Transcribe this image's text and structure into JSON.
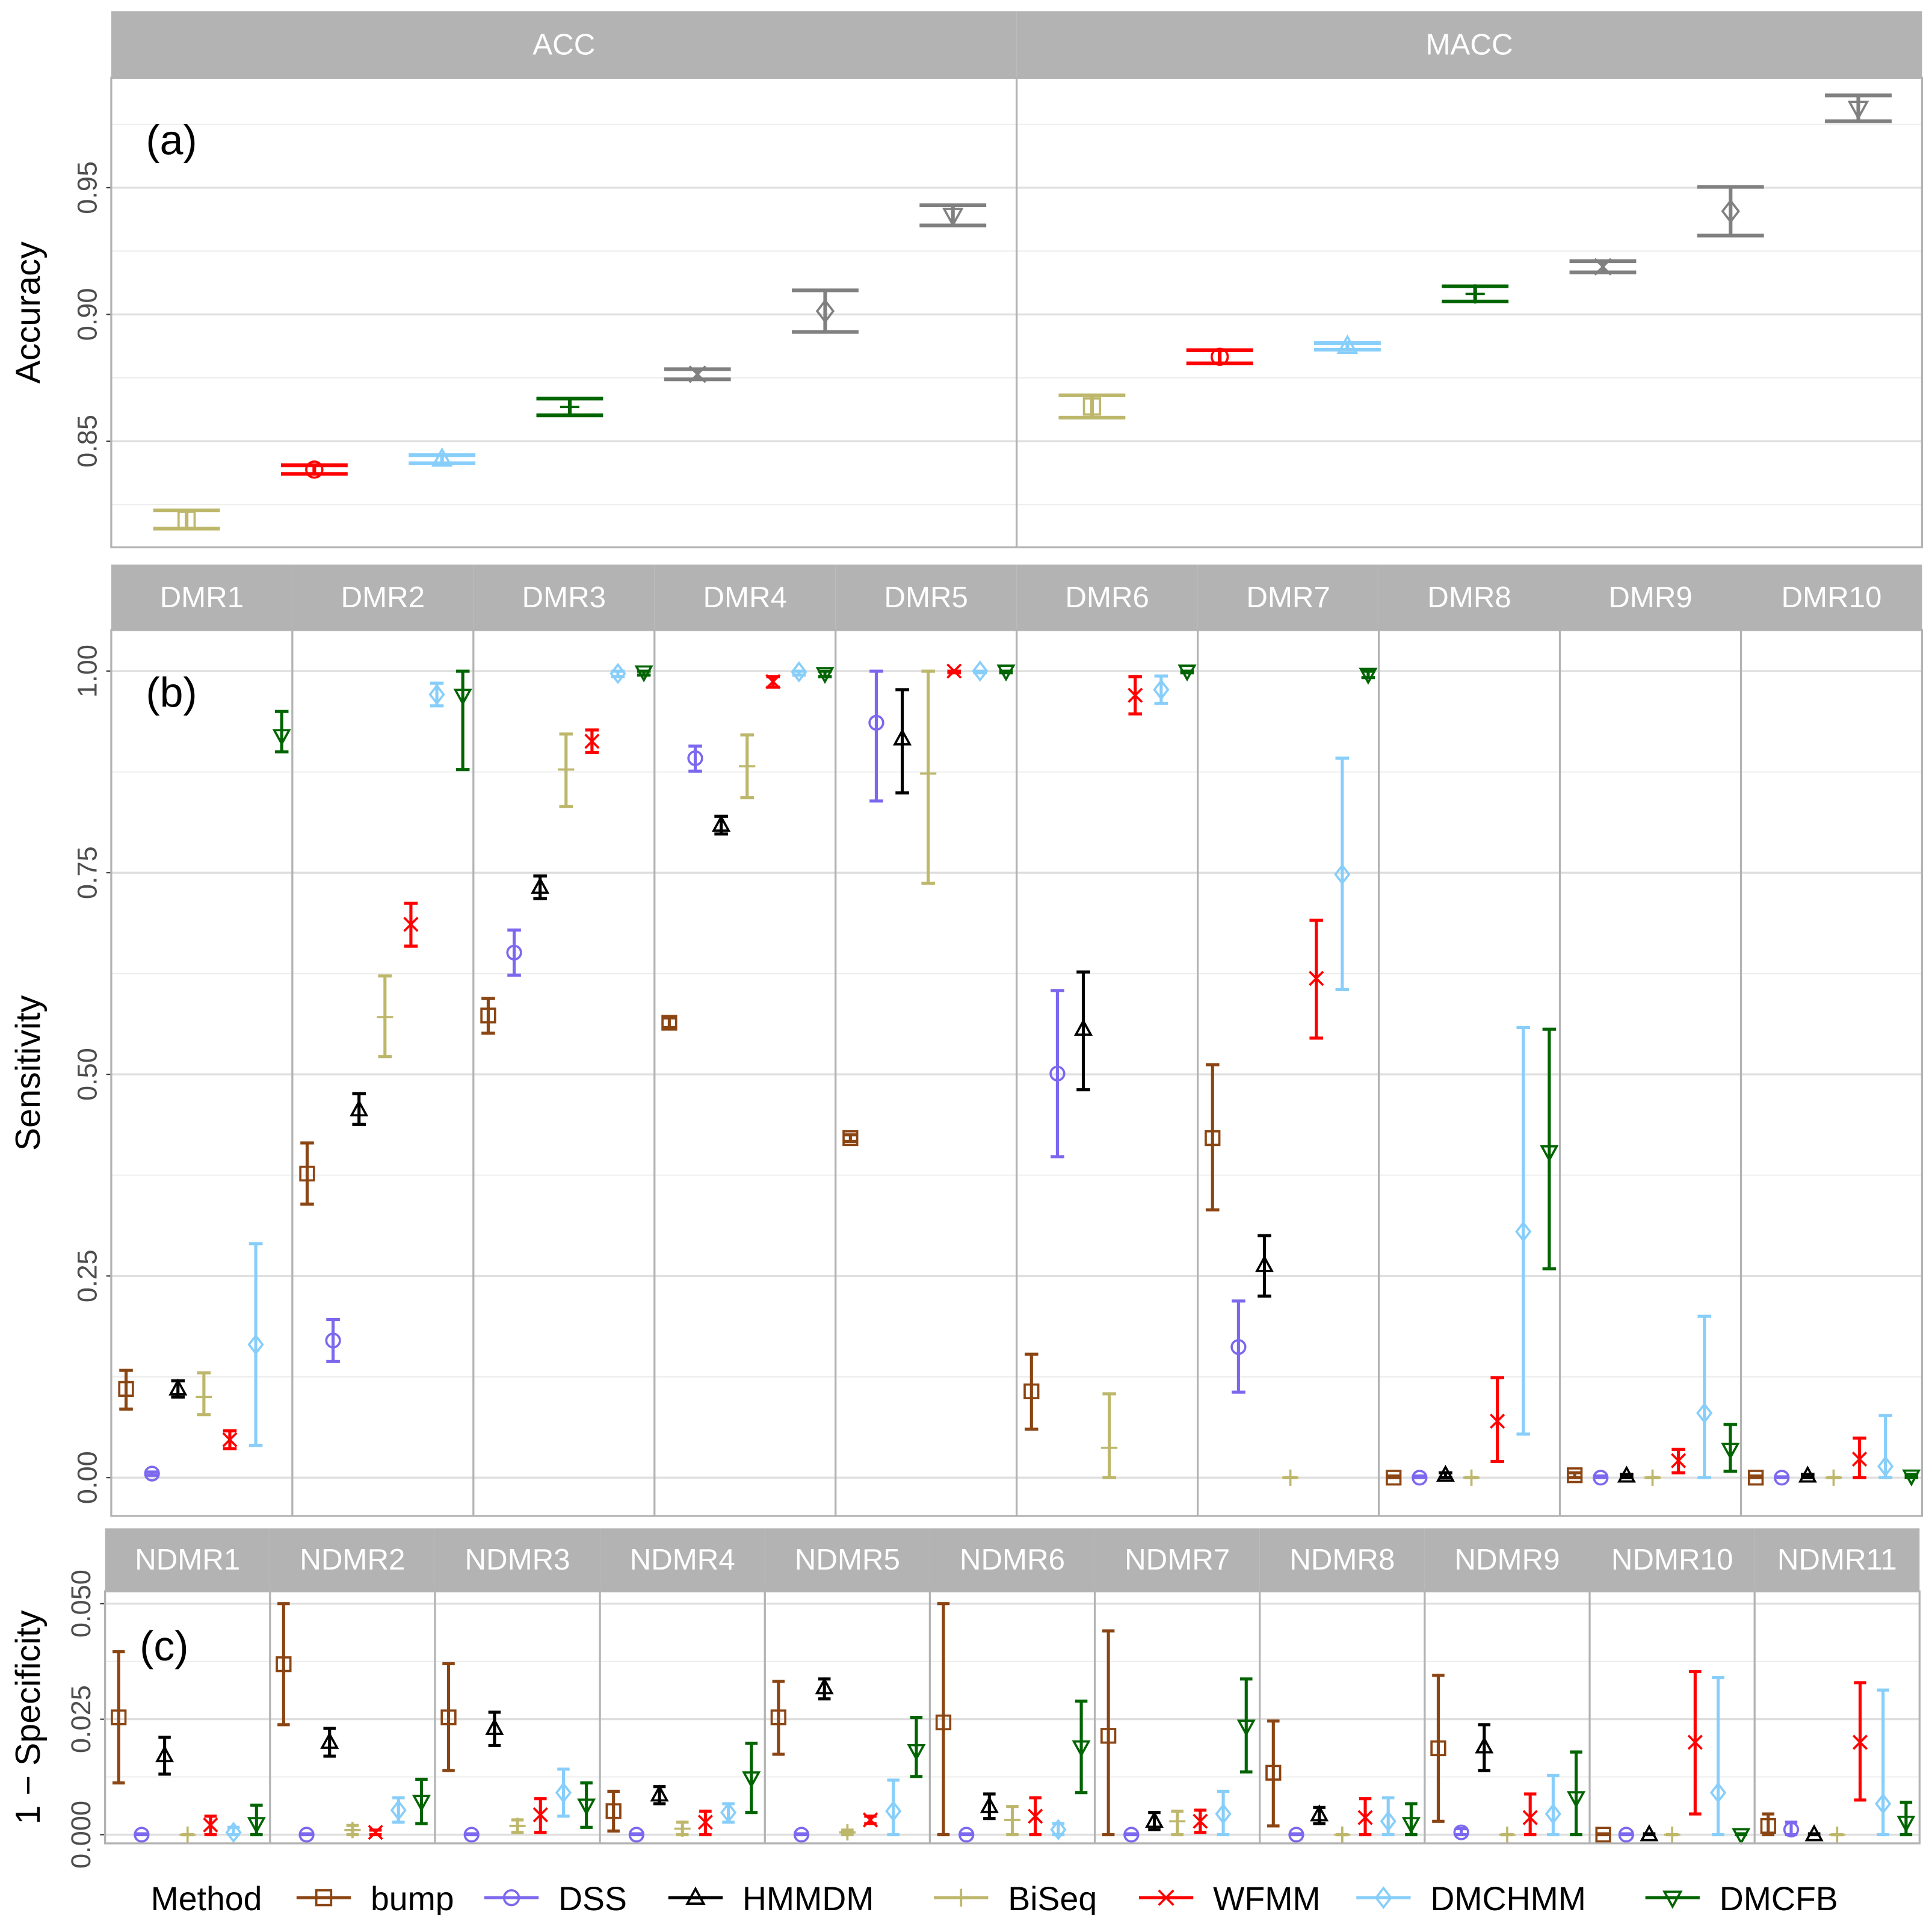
{
  "legend": {
    "title": "Method",
    "methods": [
      "bump",
      "DSS",
      "HMMDM",
      "BiSeq",
      "WFMM",
      "DMCHMM",
      "DMCFB"
    ],
    "colors": [
      "#8B4513",
      "#7B68EE",
      "#000000",
      "#BDB76B",
      "#FF0000",
      "#87CEFA",
      "#006400"
    ],
    "shapes": [
      "square",
      "circle",
      "triangle",
      "plus",
      "cross",
      "diamond",
      "triangle-down"
    ]
  },
  "chart_data": [
    {
      "type": "scatter",
      "panel_label": "(a)",
      "ylabel": "Accuracy",
      "yticks": [
        "0.85",
        "0.90",
        "0.95"
      ],
      "ytick_values": [
        0.85,
        0.9,
        0.95
      ],
      "ylim": [
        0.8085,
        0.9995
      ],
      "point_colors": [
        "#BDB76B",
        "#FF0000",
        "#87CEFA",
        "#006400",
        "#808080",
        "#808080",
        "#808080"
      ],
      "point_shapes": [
        "square",
        "circle",
        "triangle",
        "plus",
        "cross",
        "diamond",
        "triangle-down"
      ],
      "facets": [
        {
          "label": "ACC",
          "points": [
            [
              0.819,
              0.8155,
              0.8227
            ],
            [
              0.8388,
              0.8371,
              0.8405
            ],
            [
              0.8429,
              0.8413,
              0.8445
            ],
            [
              0.8635,
              0.8602,
              0.8668
            ],
            [
              0.8764,
              0.8744,
              0.8784
            ],
            [
              0.9013,
              0.8931,
              0.9095
            ],
            [
              0.9391,
              0.9351,
              0.9431
            ]
          ]
        },
        {
          "label": "MACC",
          "points": [
            [
              0.8637,
              0.8593,
              0.8681
            ],
            [
              0.8833,
              0.8807,
              0.8859
            ],
            [
              0.8874,
              0.8861,
              0.8887
            ],
            [
              0.9081,
              0.9051,
              0.9111
            ],
            [
              0.9188,
              0.9166,
              0.921
            ],
            [
              0.9407,
              0.9311,
              0.9503
            ],
            [
              0.9813,
              0.9762,
              0.9864
            ]
          ]
        }
      ]
    },
    {
      "type": "scatter",
      "panel_label": "(b)",
      "ylabel": "Sensitivity",
      "yticks": [
        "0.00",
        "0.25",
        "0.50",
        "0.75",
        "1.00"
      ],
      "ytick_values": [
        0,
        0.25,
        0.5,
        0.75,
        1.0
      ],
      "ylim": [
        -0.047,
        1.05
      ],
      "facets": [
        {
          "label": "DMR1",
          "points": [
            [
              0.11,
              0.085,
              0.133
            ],
            [
              0.005,
              0.003,
              0.007
            ],
            [
              0.11,
              0.1,
              0.12
            ],
            [
              0.1,
              0.078,
              0.13
            ],
            [
              0.047,
              0.036,
              0.058
            ],
            [
              0.165,
              0.04,
              0.29
            ],
            [
              0.92,
              0.9,
              0.95
            ]
          ]
        },
        {
          "label": "DMR2",
          "points": [
            [
              0.377,
              0.339,
              0.415
            ],
            [
              0.17,
              0.144,
              0.196
            ],
            [
              0.456,
              0.438,
              0.476
            ],
            [
              0.571,
              0.522,
              0.622
            ],
            [
              0.686,
              0.659,
              0.712
            ],
            [
              0.971,
              0.957,
              0.985
            ],
            [
              0.97,
              0.878,
              1.0
            ]
          ]
        },
        {
          "label": "DMR3",
          "points": [
            [
              0.573,
              0.551,
              0.594
            ],
            [
              0.651,
              0.623,
              0.679
            ],
            [
              0.732,
              0.718,
              0.746
            ],
            [
              0.878,
              0.832,
              0.922
            ],
            [
              0.913,
              0.899,
              0.927
            ],
            [
              0.997,
              0.993,
              1.0
            ],
            [
              0.999,
              0.995,
              1.0
            ]
          ]
        },
        {
          "label": "DMR4",
          "points": [
            [
              0.564,
              0.558,
              0.57
            ],
            [
              0.892,
              0.876,
              0.907
            ],
            [
              0.809,
              0.798,
              0.82
            ],
            [
              0.882,
              0.843,
              0.921
            ],
            [
              0.987,
              0.98,
              0.993
            ],
            [
              0.999,
              0.995,
              1.0
            ],
            [
              0.997,
              0.993,
              1.0
            ]
          ]
        },
        {
          "label": "DMR5",
          "points": [
            [
              0.421,
              0.417,
              0.425
            ],
            [
              0.936,
              0.839,
              1.0
            ],
            [
              0.916,
              0.849,
              0.977
            ],
            [
              0.873,
              0.737,
              1.0
            ],
            [
              1.0,
              0.998,
              1.0
            ],
            [
              1.0,
              0.998,
              1.0
            ],
            [
              1.0,
              0.998,
              1.0
            ]
          ]
        },
        {
          "label": "DMR6",
          "points": [
            [
              0.107,
              0.06,
              0.153
            ],
            [
              0.501,
              0.398,
              0.604
            ],
            [
              0.556,
              0.481,
              0.627
            ],
            [
              0.037,
              0.0,
              0.104
            ],
            [
              0.97,
              0.947,
              0.993
            ],
            [
              0.977,
              0.96,
              0.994
            ],
            [
              1.0,
              0.998,
              1.0
            ]
          ]
        },
        {
          "label": "DMR7",
          "points": [
            [
              0.421,
              0.332,
              0.512
            ],
            [
              0.162,
              0.106,
              0.219
            ],
            [
              0.263,
              0.225,
              0.3
            ],
            [
              0.0,
              0.0,
              0.0
            ],
            [
              0.619,
              0.545,
              0.691
            ],
            [
              0.748,
              0.605,
              0.892
            ],
            [
              0.996,
              0.992,
              1.0
            ]
          ]
        },
        {
          "label": "DMR8",
          "points": [
            [
              0.0,
              0.0,
              0.002
            ],
            [
              0.0,
              0.0,
              0.002
            ],
            [
              0.003,
              0.0,
              0.006
            ],
            [
              0.0,
              0.0,
              0.0
            ],
            [
              0.07,
              0.02,
              0.124
            ],
            [
              0.305,
              0.054,
              0.558
            ],
            [
              0.404,
              0.259,
              0.556
            ]
          ]
        },
        {
          "label": "DMR9",
          "points": [
            [
              0.003,
              0.0,
              0.006
            ],
            [
              0.0,
              0.0,
              0.002
            ],
            [
              0.002,
              0.0,
              0.004
            ],
            [
              0.0,
              0.0,
              0.0
            ],
            [
              0.021,
              0.006,
              0.035
            ],
            [
              0.08,
              0.0,
              0.2
            ],
            [
              0.035,
              0.008,
              0.066
            ]
          ]
        },
        {
          "label": "DMR10",
          "points": [
            [
              0.0,
              0.0,
              0.002
            ],
            [
              0.0,
              0.0,
              0.001
            ],
            [
              0.002,
              0.0,
              0.004
            ],
            [
              0.0,
              0.0,
              0.0
            ],
            [
              0.023,
              0.0,
              0.049
            ],
            [
              0.014,
              0.0,
              0.077
            ],
            [
              0.002,
              0.0,
              0.004
            ]
          ]
        }
      ]
    },
    {
      "type": "scatter",
      "panel_label": "(c)",
      "ylabel": "1 − Specificity",
      "yticks": [
        "0.000",
        "0.025",
        "0.050"
      ],
      "ytick_values": [
        0,
        0.025,
        0.05
      ],
      "ylim": [
        -0.0019,
        0.0524
      ],
      "facets": [
        {
          "label": "NDMR1",
          "points": [
            [
              0.0254,
              0.0112,
              0.0396
            ],
            [
              0.0,
              0.0,
              0.0002
            ],
            [
              0.0171,
              0.0131,
              0.0211
            ],
            [
              0.0,
              0.0,
              0.0
            ],
            [
              0.0021,
              0.0,
              0.004
            ],
            [
              0.0005,
              0.0,
              0.0016
            ],
            [
              0.0024,
              0.0,
              0.0064
            ]
          ]
        },
        {
          "label": "NDMR2",
          "points": [
            [
              0.0369,
              0.0238,
              0.05
            ],
            [
              0.0,
              0.0,
              0.0002
            ],
            [
              0.02,
              0.017,
              0.023
            ],
            [
              0.001,
              0.0,
              0.002
            ],
            [
              0.0005,
              0.0,
              0.001
            ],
            [
              0.0053,
              0.0027,
              0.008
            ],
            [
              0.0072,
              0.0024,
              0.012
            ]
          ]
        },
        {
          "label": "NDMR3",
          "points": [
            [
              0.0254,
              0.0139,
              0.037
            ],
            [
              0.0,
              0.0,
              0.0002
            ],
            [
              0.023,
              0.0193,
              0.0265
            ],
            [
              0.0019,
              0.0005,
              0.0032
            ],
            [
              0.0043,
              0.0005,
              0.0078
            ],
            [
              0.0091,
              0.004,
              0.0142
            ],
            [
              0.0064,
              0.0016,
              0.0112
            ]
          ]
        },
        {
          "label": "NDMR4",
          "points": [
            [
              0.0051,
              0.0008,
              0.0094
            ],
            [
              0.0,
              0.0,
              0.0002
            ],
            [
              0.0086,
              0.0067,
              0.0104
            ],
            [
              0.0013,
              0.0,
              0.0027
            ],
            [
              0.0027,
              0.0,
              0.0051
            ],
            [
              0.0048,
              0.0027,
              0.0067
            ],
            [
              0.0123,
              0.0048,
              0.0198
            ]
          ]
        },
        {
          "label": "NDMR5",
          "points": [
            [
              0.0254,
              0.0174,
              0.0332
            ],
            [
              0.0,
              0.0,
              0.0002
            ],
            [
              0.0318,
              0.0294,
              0.0337
            ],
            [
              0.0005,
              0.0,
              0.001
            ],
            [
              0.0032,
              0.0024,
              0.004
            ],
            [
              0.0051,
              0.0,
              0.0118
            ],
            [
              0.0182,
              0.0126,
              0.0254
            ]
          ]
        },
        {
          "label": "NDMR6",
          "points": [
            [
              0.0243,
              0.0,
              0.05
            ],
            [
              0.0,
              0.0,
              0.0002
            ],
            [
              0.0061,
              0.0035,
              0.0088
            ],
            [
              0.0032,
              0.0,
              0.0061
            ],
            [
              0.004,
              0.0,
              0.008
            ],
            [
              0.0011,
              0.0,
              0.0024
            ],
            [
              0.019,
              0.0091,
              0.0289
            ]
          ]
        },
        {
          "label": "NDMR7",
          "points": [
            [
              0.0214,
              0.0,
              0.0441
            ],
            [
              0.0,
              0.0,
              0.0002
            ],
            [
              0.0029,
              0.0011,
              0.0048
            ],
            [
              0.0029,
              0.0,
              0.0051
            ],
            [
              0.0029,
              0.0005,
              0.0053
            ],
            [
              0.0045,
              0.0,
              0.0094
            ],
            [
              0.0235,
              0.0136,
              0.0337
            ]
          ]
        },
        {
          "label": "NDMR8",
          "points": [
            [
              0.0134,
              0.0019,
              0.0246
            ],
            [
              0.0,
              0.0,
              0.0002
            ],
            [
              0.0043,
              0.0024,
              0.0059
            ],
            [
              0.0,
              0.0,
              0.0
            ],
            [
              0.0037,
              0.0,
              0.0078
            ],
            [
              0.0029,
              0.0,
              0.008
            ],
            [
              0.0024,
              0.0,
              0.0067
            ]
          ]
        },
        {
          "label": "NDMR9",
          "points": [
            [
              0.0187,
              0.0029,
              0.0345
            ],
            [
              0.0005,
              0.0,
              0.0013
            ],
            [
              0.019,
              0.0139,
              0.0238
            ],
            [
              0.0,
              0.0,
              0.0
            ],
            [
              0.0037,
              0.0,
              0.0088
            ],
            [
              0.0045,
              0.0,
              0.0128
            ],
            [
              0.008,
              0.0,
              0.0179
            ]
          ]
        },
        {
          "label": "NDMR10",
          "points": [
            [
              0.0,
              0.0,
              0.0002
            ],
            [
              0.0,
              0.0,
              0.0002
            ],
            [
              0.0,
              0.0,
              0.0002
            ],
            [
              0.0,
              0.0,
              0.0
            ],
            [
              0.02,
              0.0045,
              0.0353
            ],
            [
              0.0091,
              0.0,
              0.034
            ],
            [
              0.0,
              0.0,
              0.0002
            ]
          ]
        },
        {
          "label": "NDMR11",
          "points": [
            [
              0.0019,
              0.0,
              0.0045
            ],
            [
              0.0011,
              0.0,
              0.0027
            ],
            [
              0.0,
              0.0,
              0.0002
            ],
            [
              0.0,
              0.0,
              0.0
            ],
            [
              0.02,
              0.0075,
              0.0329
            ],
            [
              0.0067,
              0.0,
              0.0313
            ],
            [
              0.0027,
              0.0,
              0.007
            ]
          ]
        }
      ]
    }
  ]
}
